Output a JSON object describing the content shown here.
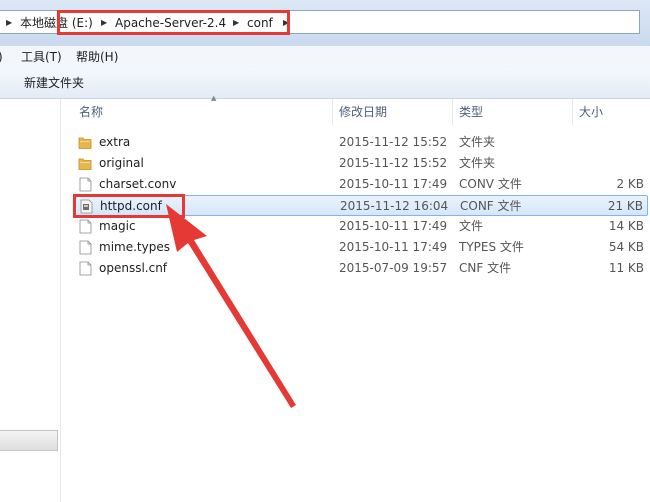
{
  "breadcrumb": {
    "items": [
      "本地磁盘 (E:)",
      "Apache-Server-2.4",
      "conf"
    ]
  },
  "menu": {
    "items": [
      "工具(T)",
      "帮助(H)"
    ]
  },
  "toolbar": {
    "new_folder_label": "新建文件夹"
  },
  "columns": {
    "name": "名称",
    "date": "修改日期",
    "type": "类型",
    "size": "大小"
  },
  "files": [
    {
      "name": "extra",
      "date": "2015-11-12 15:52",
      "type": "文件夹",
      "size": "",
      "icon": "folder-icon"
    },
    {
      "name": "original",
      "date": "2015-11-12 15:52",
      "type": "文件夹",
      "size": "",
      "icon": "folder-icon"
    },
    {
      "name": "charset.conv",
      "date": "2015-10-11 17:49",
      "type": "CONV 文件",
      "size": "2 KB",
      "icon": "file-icon"
    },
    {
      "name": "httpd.conf",
      "date": "2015-11-12 16:04",
      "type": "CONF 文件",
      "size": "21 KB",
      "icon": "config-file-icon"
    },
    {
      "name": "magic",
      "date": "2015-10-11 17:49",
      "type": "文件",
      "size": "14 KB",
      "icon": "file-icon"
    },
    {
      "name": "mime.types",
      "date": "2015-10-11 17:49",
      "type": "TYPES 文件",
      "size": "54 KB",
      "icon": "file-icon"
    },
    {
      "name": "openssl.cnf",
      "date": "2015-07-09 19:57",
      "type": "CNF 文件",
      "size": "11 KB",
      "icon": "file-icon"
    }
  ],
  "selected_file": "httpd.conf",
  "colors": {
    "annotation": "#e53935",
    "selection_border": "#86b2e8",
    "folder": "#e8b64a"
  }
}
